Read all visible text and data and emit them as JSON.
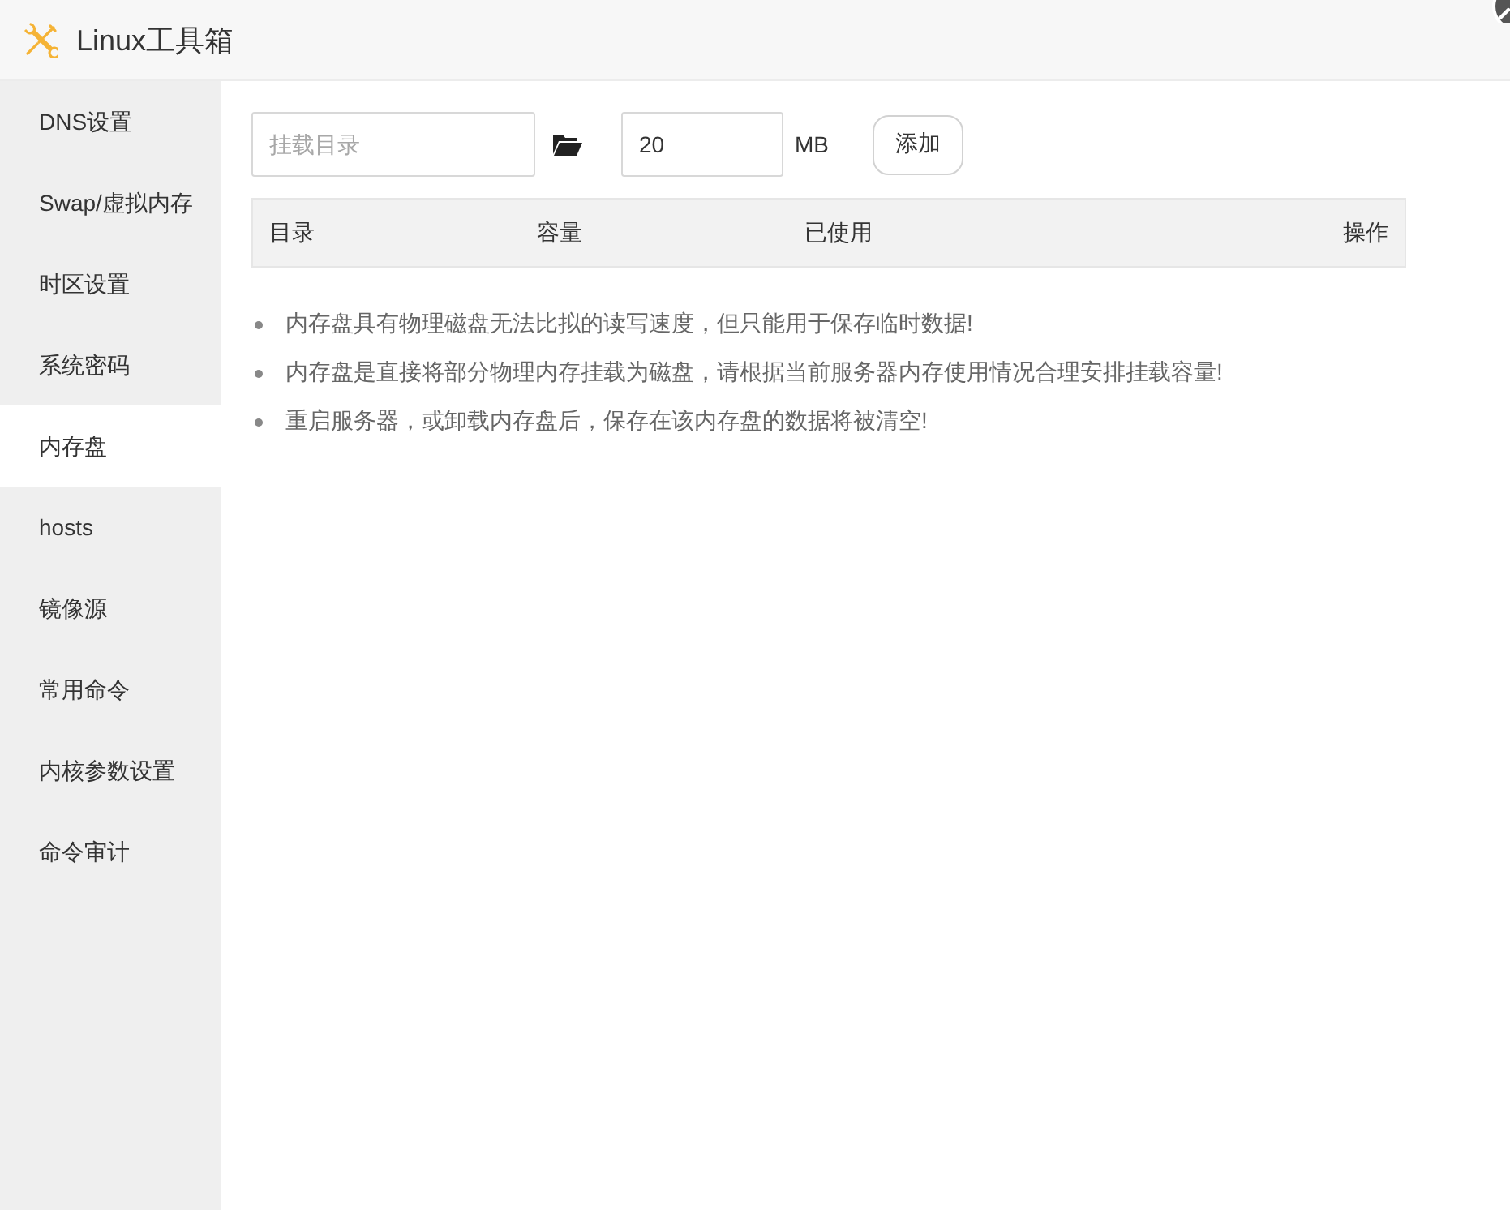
{
  "window": {
    "title": "Linux工具箱"
  },
  "sidebar": {
    "items": [
      {
        "label": "DNS设置",
        "selected": false
      },
      {
        "label": "Swap/虚拟内存",
        "selected": false
      },
      {
        "label": "时区设置",
        "selected": false
      },
      {
        "label": "系统密码",
        "selected": false
      },
      {
        "label": "内存盘",
        "selected": true
      },
      {
        "label": "hosts",
        "selected": false
      },
      {
        "label": "镜像源",
        "selected": false
      },
      {
        "label": "常用命令",
        "selected": false
      },
      {
        "label": "内核参数设置",
        "selected": false
      },
      {
        "label": "命令审计",
        "selected": false
      }
    ]
  },
  "mount_form": {
    "directory": {
      "placeholder": "挂载目录"
    },
    "size": {
      "value": "20"
    },
    "unit": "MB",
    "add_button": "添加"
  },
  "table": {
    "columns": [
      "目录",
      "容量",
      "已使用",
      "操作"
    ]
  },
  "notes": [
    "内存盘具有物理磁盘无法比拟的读写速度，但只能用于保存临时数据!",
    "内存盘是直接将部分物理内存挂载为磁盘，请根据当前服务器内存使用情况合理安排挂载容量!",
    "重启服务器，或卸载内存盘后，保存在该内存盘的数据将被清空!"
  ]
}
